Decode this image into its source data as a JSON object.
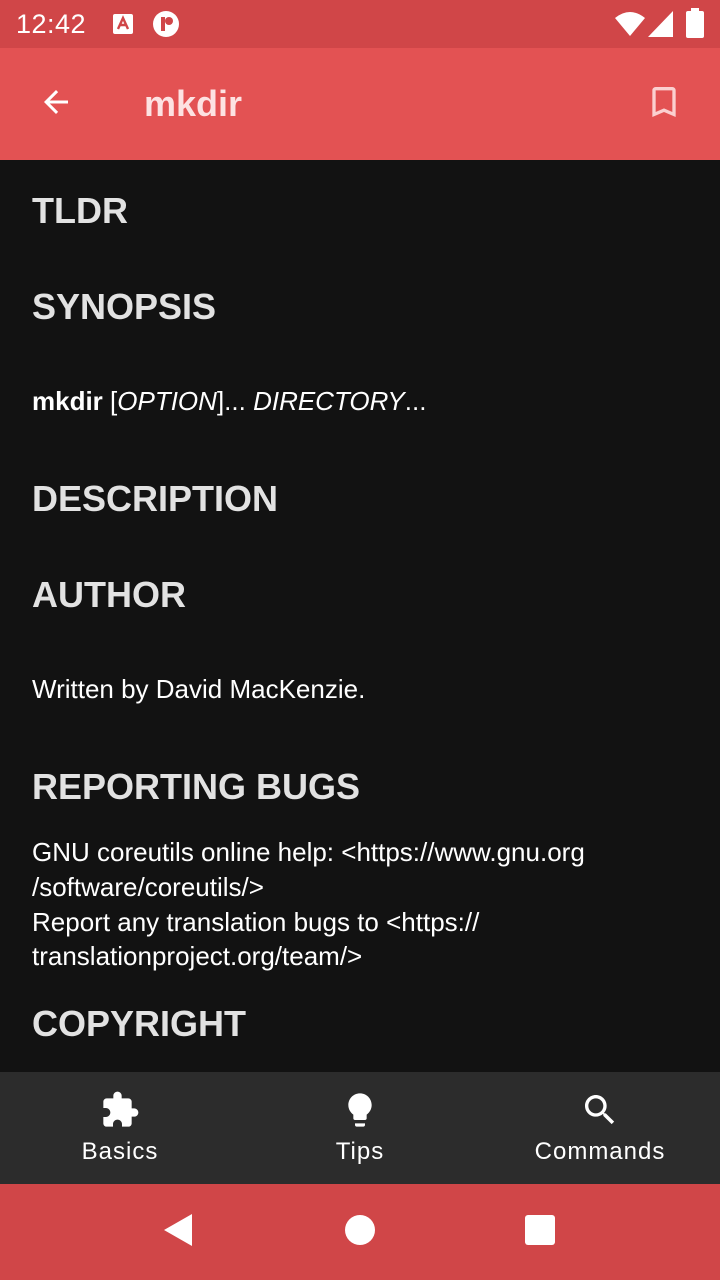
{
  "status_bar": {
    "time": "12:42",
    "icons": [
      "notification-a-icon",
      "notification-p-icon",
      "wifi-icon",
      "signal-icon",
      "battery-icon"
    ]
  },
  "app_bar": {
    "title": "mkdir",
    "back_icon": "arrow-back-icon",
    "bookmark_icon": "bookmark-outline-icon"
  },
  "sections": {
    "tldr": {
      "heading": "TLDR"
    },
    "synopsis": {
      "heading": "SYNOPSIS",
      "command": "mkdir",
      "part1": " [",
      "option": "OPTION",
      "part2": "]... ",
      "directory": "DIRECTORY",
      "part3": "..."
    },
    "description": {
      "heading": "DESCRIPTION"
    },
    "author": {
      "heading": "AUTHOR",
      "text": "Written by David MacKenzie."
    },
    "reporting_bugs": {
      "heading": "REPORTING BUGS",
      "lines": [
        "GNU coreutils online help: <https://www.gnu.org",
        "/software/coreutils/>",
        "Report any translation bugs to <https://",
        "translationproject.org/team/>"
      ]
    },
    "copyright": {
      "heading": "COPYRIGHT"
    }
  },
  "bottom_nav": {
    "items": [
      {
        "label": "Basics",
        "icon": "puzzle-icon"
      },
      {
        "label": "Tips",
        "icon": "lightbulb-icon"
      },
      {
        "label": "Commands",
        "icon": "search-icon"
      }
    ]
  },
  "system_nav": {
    "icons": [
      "back-triangle-icon",
      "home-circle-icon",
      "recents-square-icon"
    ]
  },
  "colors": {
    "status_bar": "#d04648",
    "app_bar": "#e35253",
    "background": "#121212",
    "bottom_nav": "#2c2c2c",
    "heading_text": "#e2e2e2"
  }
}
